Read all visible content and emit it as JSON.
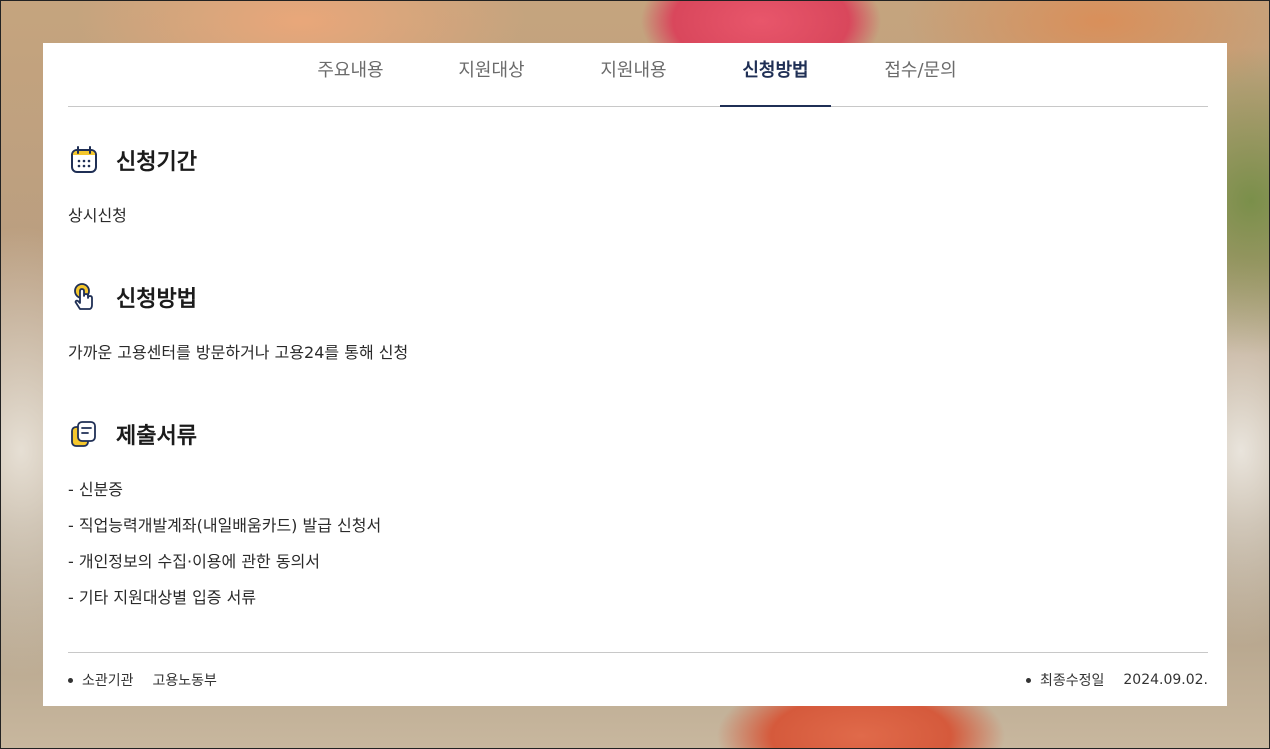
{
  "tabs": [
    {
      "label": "주요내용",
      "active": false
    },
    {
      "label": "지원대상",
      "active": false
    },
    {
      "label": "지원내용",
      "active": false
    },
    {
      "label": "신청방법",
      "active": true
    },
    {
      "label": "접수/문의",
      "active": false
    }
  ],
  "sections": {
    "period": {
      "title": "신청기간",
      "icon": "calendar-icon",
      "text": "상시신청"
    },
    "method": {
      "title": "신청방법",
      "icon": "pointer-hand-icon",
      "text": "가까운 고용센터를 방문하거나 고용24를 통해 신청"
    },
    "documents": {
      "title": "제출서류",
      "icon": "documents-icon",
      "items": [
        "- 신분증",
        "- 직업능력개발계좌(내일배움카드) 발급 신청서",
        "- 개인정보의 수집·이용에 관한 동의서",
        "- 기타 지원대상별 입증 서류"
      ]
    }
  },
  "footer": {
    "agency_label": "소관기관",
    "agency_value": "고용노동부",
    "updated_label": "최종수정일",
    "updated_value": "2024.09.02."
  },
  "colors": {
    "accent": "#1f2f55",
    "icon_yellow": "#f5c72c"
  }
}
